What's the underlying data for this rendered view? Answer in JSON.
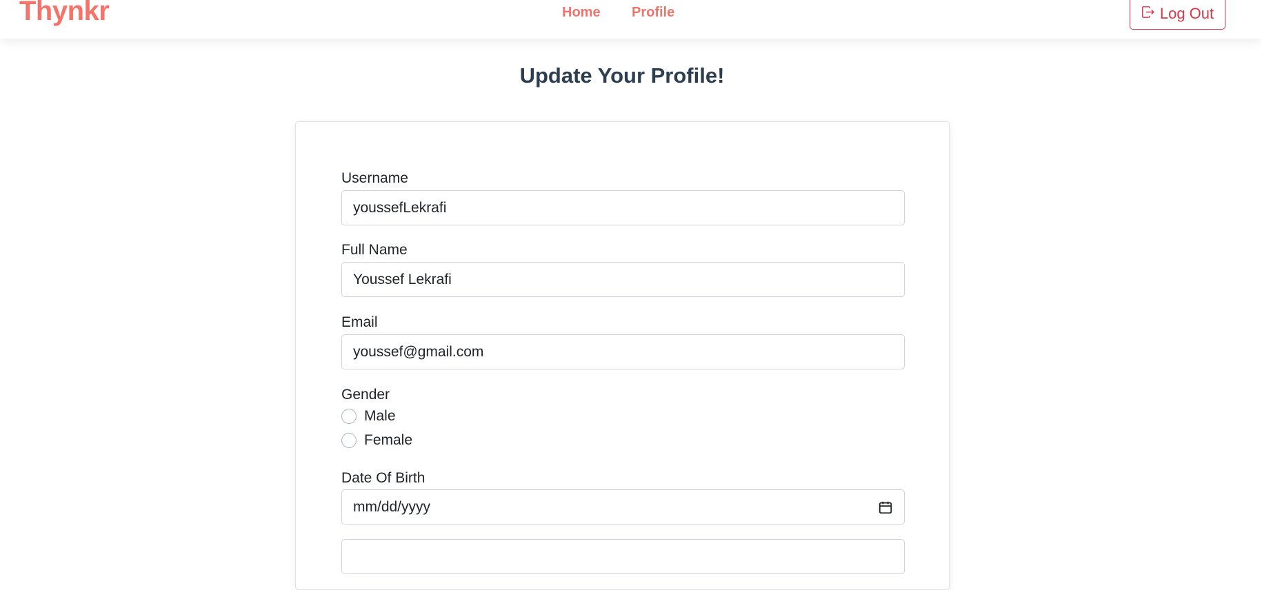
{
  "navbar": {
    "brand": "Thynkr",
    "links": [
      {
        "label": "Home"
      },
      {
        "label": "Profile"
      }
    ],
    "logout_label": "Log Out",
    "logout_icon": "box-arrow-right-icon"
  },
  "page": {
    "title": "Update Your Profile!"
  },
  "form": {
    "username": {
      "label": "Username",
      "value": "youssefLekrafi"
    },
    "full_name": {
      "label": "Full Name",
      "value": "Youssef Lekrafi"
    },
    "email": {
      "label": "Email",
      "value": "youssef@gmail.com"
    },
    "gender": {
      "label": "Gender",
      "options": [
        "Male",
        "Female"
      ],
      "selected": null
    },
    "dob": {
      "label": "Date Of Birth",
      "placeholder": "mm/dd/yyyy",
      "icon": "calendar-icon"
    },
    "next_field": {
      "value": ""
    }
  },
  "colors": {
    "brand": "#f4736a",
    "danger": "#dc3545",
    "title": "#2c3e50",
    "border": "#ced4da"
  }
}
